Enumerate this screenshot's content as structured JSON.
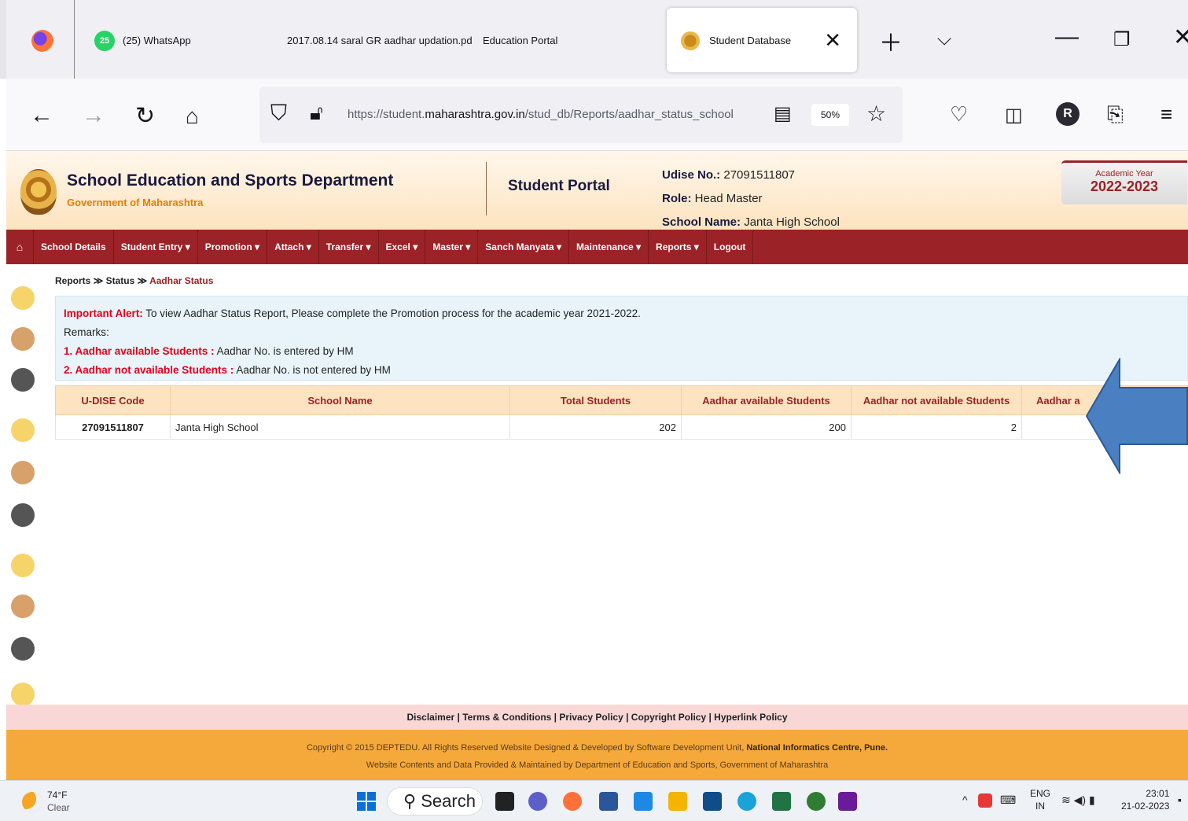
{
  "browser": {
    "tabs": [
      {
        "label": "(25) WhatsApp",
        "badge": "25"
      },
      {
        "label": "2017.08.14 saral GR aadhar updation.pd"
      },
      {
        "label": "Education Portal"
      }
    ],
    "active_tab": {
      "label": "Student Database"
    },
    "url_prefix": "https://student.",
    "url_domain": "maharashtra.gov.in",
    "url_path": "/stud_db/Reports/aadhar_status_school",
    "zoom": "50%",
    "profile_initial": "R"
  },
  "header": {
    "dept_title": "School Education and Sports Department",
    "gov": "Government of Maharashtra",
    "portal": "Student Portal",
    "udise_label": "Udise No.:",
    "udise_value": "27091511807",
    "role_label": "Role:",
    "role_value": "Head Master",
    "school_label": "School Name:",
    "school_value": "Janta High School",
    "ay_label": "Academic Year",
    "ay_value": "2022-2023"
  },
  "menu": [
    "School Details",
    "Student Entry ▾",
    "Promotion ▾",
    "Attach ▾",
    "Transfer ▾",
    "Excel ▾",
    "Master ▾",
    "Sanch Manyata ▾",
    "Maintenance ▾",
    "Reports ▾",
    "Logout"
  ],
  "breadcrumb": {
    "a": "Reports",
    "b": "Status",
    "c": "Aadhar Status",
    "sep": "≫"
  },
  "alert": {
    "label": "Important Alert:",
    "text": "To view Aadhar Status Report, Please complete the Promotion process for the academic year 2021-2022.",
    "remarks": "Remarks:",
    "r1_label": "1. Aadhar available Students :",
    "r1_text": "Aadhar No. is entered by HM",
    "r2_label": "2. Aadhar not available Students :",
    "r2_text": "Aadhar No. is not entered by HM"
  },
  "table": {
    "headers": [
      "U-DISE Code",
      "School Name",
      "Total Students",
      "Aadhar available Students",
      "Aadhar not available Students",
      "Aadhar a"
    ],
    "row": {
      "udise": "27091511807",
      "school": "Janta High School",
      "total": "202",
      "available": "200",
      "not_available": "2",
      "pct": ""
    }
  },
  "footer": {
    "links": [
      "Disclaimer",
      "Terms & Conditions",
      "Privacy Policy",
      "Copyright Policy",
      "Hyperlink Policy"
    ],
    "copy1_a": "Copyright © 2015 DEPTEDU. All Rights Reserved Website Designed & Developed by Software Development Unit,",
    "copy1_b": "National Informatics Centre, Pune.",
    "copy2": "Website Contents and Data Provided & Maintained by Department of Education and Sports, Government of Maharashtra"
  },
  "taskbar": {
    "temp": "74°F",
    "weather": "Clear",
    "search": "Search",
    "lang1": "ENG",
    "lang2": "IN",
    "time": "23:01",
    "date": "21-02-2023"
  },
  "colors": {
    "menu": "#9b2226",
    "header_bg": "#fde3bf",
    "arrow": "#4a7fc1",
    "alert_red": "#e3001b",
    "footer": "#f6a93b"
  }
}
